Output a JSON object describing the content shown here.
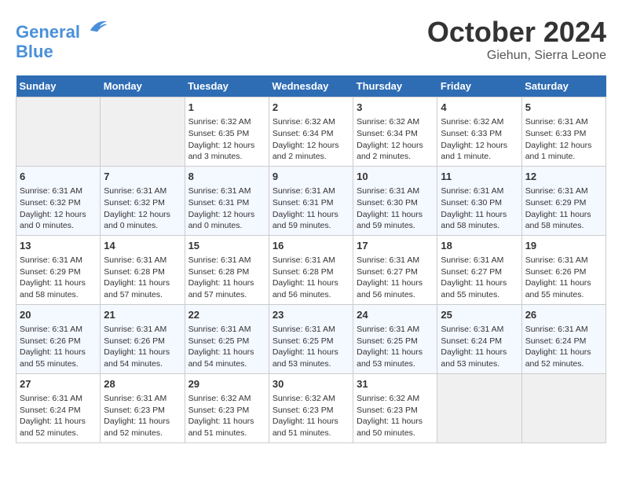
{
  "header": {
    "logo_line1": "General",
    "logo_line2": "Blue",
    "month": "October 2024",
    "location": "Giehun, Sierra Leone"
  },
  "columns": [
    "Sunday",
    "Monday",
    "Tuesday",
    "Wednesday",
    "Thursday",
    "Friday",
    "Saturday"
  ],
  "weeks": [
    [
      {
        "day": "",
        "empty": true
      },
      {
        "day": "",
        "empty": true
      },
      {
        "day": "1",
        "sunrise": "6:32 AM",
        "sunset": "6:35 PM",
        "daylight": "12 hours and 3 minutes."
      },
      {
        "day": "2",
        "sunrise": "6:32 AM",
        "sunset": "6:34 PM",
        "daylight": "12 hours and 2 minutes."
      },
      {
        "day": "3",
        "sunrise": "6:32 AM",
        "sunset": "6:34 PM",
        "daylight": "12 hours and 2 minutes."
      },
      {
        "day": "4",
        "sunrise": "6:32 AM",
        "sunset": "6:33 PM",
        "daylight": "12 hours and 1 minute."
      },
      {
        "day": "5",
        "sunrise": "6:31 AM",
        "sunset": "6:33 PM",
        "daylight": "12 hours and 1 minute."
      }
    ],
    [
      {
        "day": "6",
        "sunrise": "6:31 AM",
        "sunset": "6:32 PM",
        "daylight": "12 hours and 0 minutes."
      },
      {
        "day": "7",
        "sunrise": "6:31 AM",
        "sunset": "6:32 PM",
        "daylight": "12 hours and 0 minutes."
      },
      {
        "day": "8",
        "sunrise": "6:31 AM",
        "sunset": "6:31 PM",
        "daylight": "12 hours and 0 minutes."
      },
      {
        "day": "9",
        "sunrise": "6:31 AM",
        "sunset": "6:31 PM",
        "daylight": "11 hours and 59 minutes."
      },
      {
        "day": "10",
        "sunrise": "6:31 AM",
        "sunset": "6:30 PM",
        "daylight": "11 hours and 59 minutes."
      },
      {
        "day": "11",
        "sunrise": "6:31 AM",
        "sunset": "6:30 PM",
        "daylight": "11 hours and 58 minutes."
      },
      {
        "day": "12",
        "sunrise": "6:31 AM",
        "sunset": "6:29 PM",
        "daylight": "11 hours and 58 minutes."
      }
    ],
    [
      {
        "day": "13",
        "sunrise": "6:31 AM",
        "sunset": "6:29 PM",
        "daylight": "11 hours and 58 minutes."
      },
      {
        "day": "14",
        "sunrise": "6:31 AM",
        "sunset": "6:28 PM",
        "daylight": "11 hours and 57 minutes."
      },
      {
        "day": "15",
        "sunrise": "6:31 AM",
        "sunset": "6:28 PM",
        "daylight": "11 hours and 57 minutes."
      },
      {
        "day": "16",
        "sunrise": "6:31 AM",
        "sunset": "6:28 PM",
        "daylight": "11 hours and 56 minutes."
      },
      {
        "day": "17",
        "sunrise": "6:31 AM",
        "sunset": "6:27 PM",
        "daylight": "11 hours and 56 minutes."
      },
      {
        "day": "18",
        "sunrise": "6:31 AM",
        "sunset": "6:27 PM",
        "daylight": "11 hours and 55 minutes."
      },
      {
        "day": "19",
        "sunrise": "6:31 AM",
        "sunset": "6:26 PM",
        "daylight": "11 hours and 55 minutes."
      }
    ],
    [
      {
        "day": "20",
        "sunrise": "6:31 AM",
        "sunset": "6:26 PM",
        "daylight": "11 hours and 55 minutes."
      },
      {
        "day": "21",
        "sunrise": "6:31 AM",
        "sunset": "6:26 PM",
        "daylight": "11 hours and 54 minutes."
      },
      {
        "day": "22",
        "sunrise": "6:31 AM",
        "sunset": "6:25 PM",
        "daylight": "11 hours and 54 minutes."
      },
      {
        "day": "23",
        "sunrise": "6:31 AM",
        "sunset": "6:25 PM",
        "daylight": "11 hours and 53 minutes."
      },
      {
        "day": "24",
        "sunrise": "6:31 AM",
        "sunset": "6:25 PM",
        "daylight": "11 hours and 53 minutes."
      },
      {
        "day": "25",
        "sunrise": "6:31 AM",
        "sunset": "6:24 PM",
        "daylight": "11 hours and 53 minutes."
      },
      {
        "day": "26",
        "sunrise": "6:31 AM",
        "sunset": "6:24 PM",
        "daylight": "11 hours and 52 minutes."
      }
    ],
    [
      {
        "day": "27",
        "sunrise": "6:31 AM",
        "sunset": "6:24 PM",
        "daylight": "11 hours and 52 minutes."
      },
      {
        "day": "28",
        "sunrise": "6:31 AM",
        "sunset": "6:23 PM",
        "daylight": "11 hours and 52 minutes."
      },
      {
        "day": "29",
        "sunrise": "6:32 AM",
        "sunset": "6:23 PM",
        "daylight": "11 hours and 51 minutes."
      },
      {
        "day": "30",
        "sunrise": "6:32 AM",
        "sunset": "6:23 PM",
        "daylight": "11 hours and 51 minutes."
      },
      {
        "day": "31",
        "sunrise": "6:32 AM",
        "sunset": "6:23 PM",
        "daylight": "11 hours and 50 minutes."
      },
      {
        "day": "",
        "empty": true
      },
      {
        "day": "",
        "empty": true
      }
    ]
  ]
}
